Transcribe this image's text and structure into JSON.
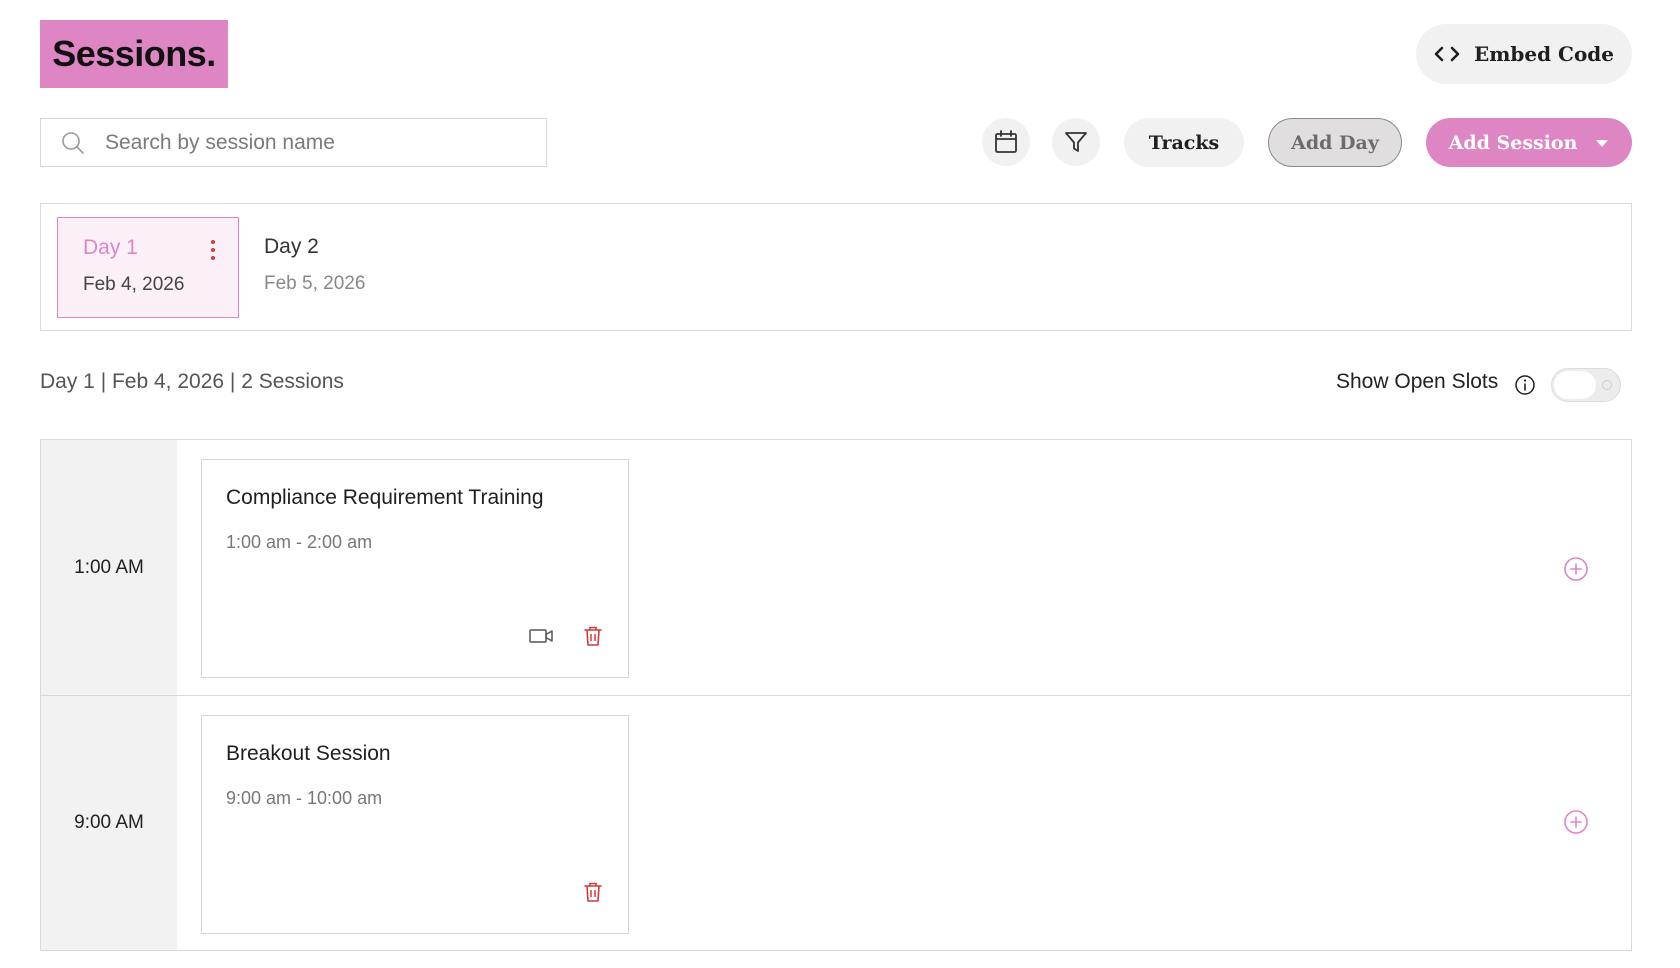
{
  "header": {
    "title": "Sessions.",
    "embed_label": "Embed Code"
  },
  "toolbar": {
    "search_placeholder": "Search by session name",
    "tracks_label": "Tracks",
    "add_day_label": "Add Day",
    "add_session_label": "Add Session"
  },
  "days": [
    {
      "name": "Day 1",
      "date": "Feb 4, 2026",
      "active": true
    },
    {
      "name": "Day 2",
      "date": "Feb 5, 2026",
      "active": false
    }
  ],
  "summary": {
    "text": "Day 1 | Feb 4, 2026 | 2 Sessions",
    "open_slots_label": "Show Open Slots",
    "open_slots_enabled": false
  },
  "schedule": [
    {
      "time": "1:00 AM",
      "session": {
        "title": "Compliance Requirement Training",
        "time_range": "1:00 am - 2:00 am",
        "has_video": true
      }
    },
    {
      "time": "9:00 AM",
      "session": {
        "title": "Breakout Session",
        "time_range": "9:00 am - 10:00 am",
        "has_video": false
      }
    }
  ],
  "colors": {
    "accent": "#de86c4",
    "danger": "#d23a3a",
    "panel_bg": "#f2f2f2"
  },
  "icons": [
    "code-icon",
    "search-icon",
    "calendar-icon",
    "filter-icon",
    "caret-down-icon",
    "kebab-icon",
    "info-icon",
    "video-icon",
    "trash-icon",
    "plus-circle-icon"
  ]
}
